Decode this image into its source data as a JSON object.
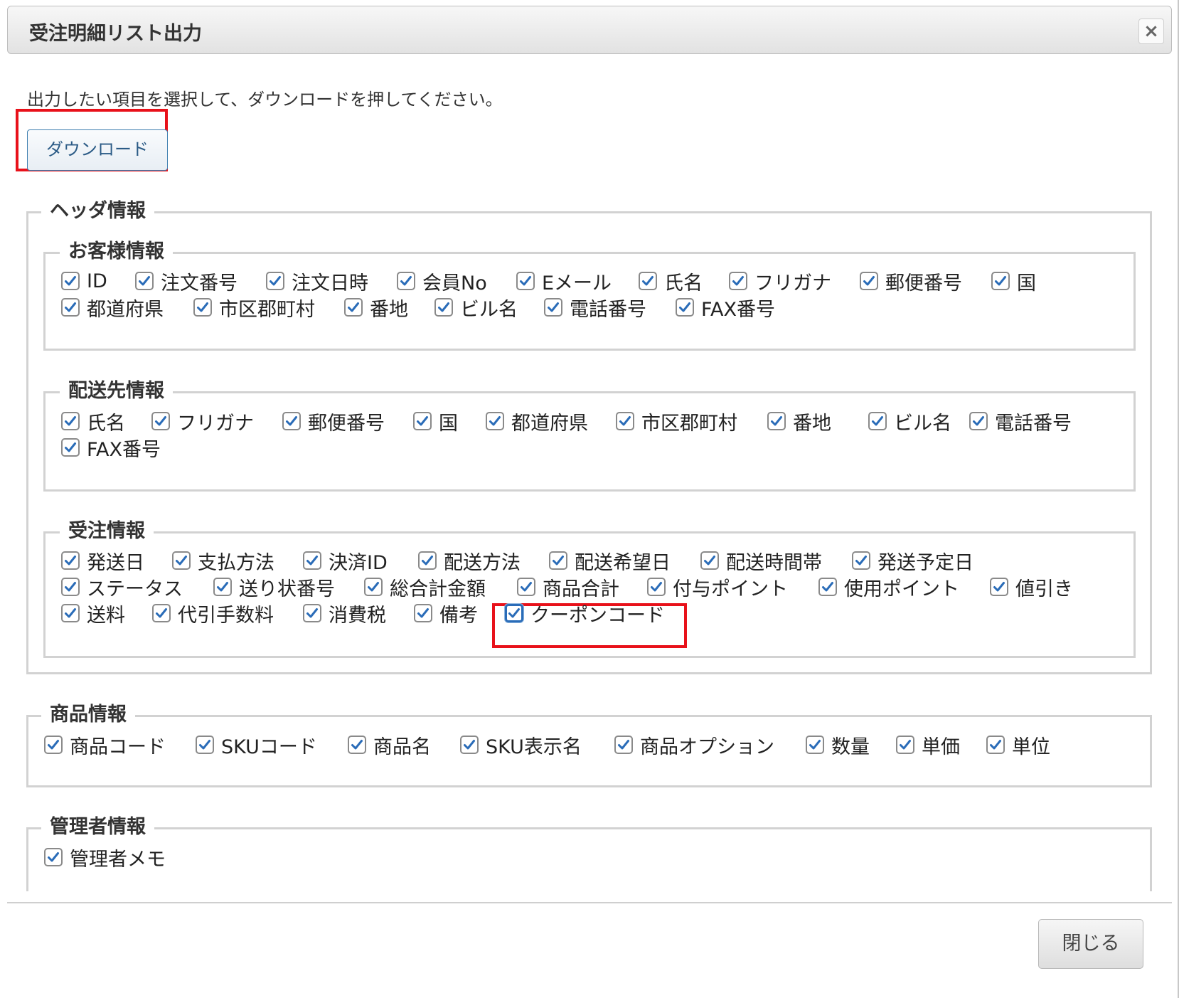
{
  "dialog": {
    "title": "受注明細リスト出力",
    "close_icon": "close-icon",
    "instruction": "出力したい項目を選択して、ダウンロードを押してください。",
    "download_label": "ダウンロード",
    "close_label": "閉じる"
  },
  "groups": {
    "header": {
      "legend": "ヘッダ情報",
      "customer": {
        "legend": "お客様情報",
        "items": [
          "ID",
          "注文番号",
          "注文日時",
          "会員No",
          "Eメール",
          "氏名",
          "フリガナ",
          "郵便番号",
          "国",
          "都道府県",
          "市区郡町村",
          "番地",
          "ビル名",
          "電話番号",
          "FAX番号"
        ]
      },
      "shipping": {
        "legend": "配送先情報",
        "items": [
          "氏名",
          "フリガナ",
          "郵便番号",
          "国",
          "都道府県",
          "市区郡町村",
          "番地",
          "ビル名",
          "電話番号",
          "FAX番号"
        ]
      },
      "order": {
        "legend": "受注情報",
        "items": [
          "発送日",
          "支払方法",
          "決済ID",
          "配送方法",
          "配送希望日",
          "配送時間帯",
          "発送予定日",
          "ステータス",
          "送り状番号",
          "総合計金額",
          "商品合計",
          "付与ポイント",
          "使用ポイント",
          "値引き",
          "送料",
          "代引手数料",
          "消費税",
          "備考",
          "クーポンコード"
        ]
      }
    },
    "product": {
      "legend": "商品情報",
      "items": [
        "商品コード",
        "SKUコード",
        "商品名",
        "SKU表示名",
        "商品オプション",
        "数量",
        "単価",
        "単位"
      ]
    },
    "admin": {
      "legend": "管理者情報",
      "items": [
        "管理者メモ"
      ]
    }
  },
  "all_checked": true,
  "highlight_color": "#e8111a",
  "check_color": "#2a6cb8"
}
